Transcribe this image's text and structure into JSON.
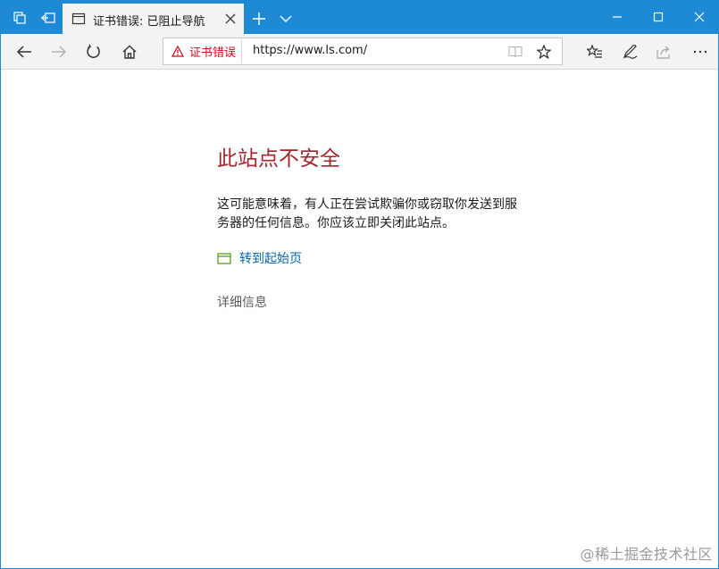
{
  "browser": {
    "tab": {
      "title": "证书错误: 已阻止导航"
    },
    "address": {
      "cert_warning": "证书错误",
      "url": "https://www.ls.com/"
    }
  },
  "page": {
    "title": "此站点不安全",
    "description": "这可能意味着，有人正在尝试欺骗你或窃取你发送到服务器的任何信息。你应该立即关闭此站点。",
    "goto_start_link": "转到起始页",
    "details_link": "详细信息"
  },
  "watermark": "@稀土掘金技术社区",
  "colors": {
    "titlebar": "#1e8ad6",
    "warning_red": "#c50f1f",
    "title_red": "#a4262c",
    "link_blue": "#0063b1",
    "home_icon_green": "#5a9e1d"
  }
}
